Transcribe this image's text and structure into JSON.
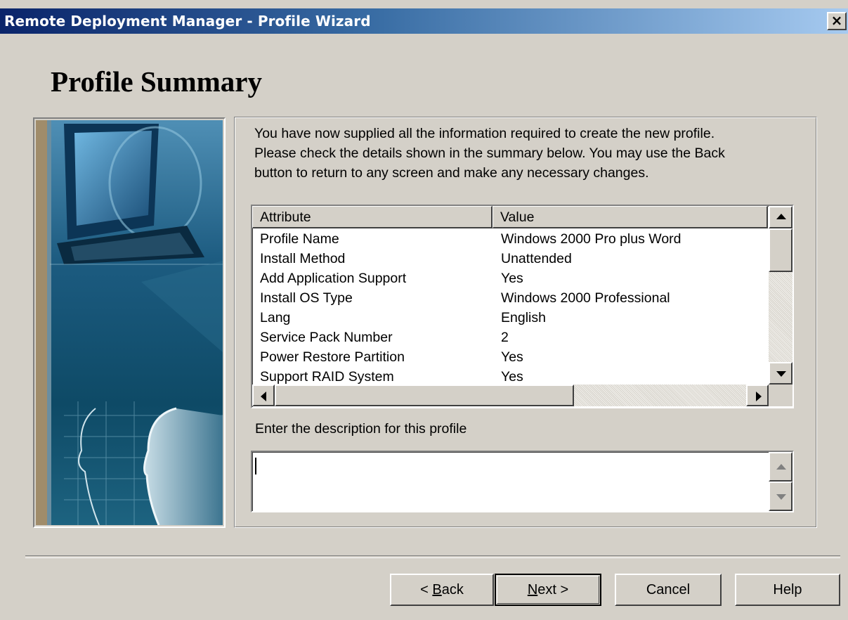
{
  "window": {
    "title": "Remote Deployment Manager - Profile Wizard",
    "close_label": "×"
  },
  "page": {
    "title": "Profile Summary"
  },
  "intro": {
    "lines": [
      "You have now supplied all the information required to create the new profile.",
      "Please check the details shown in the summary below.  You may use the Back",
      "button to return to any screen and make any necessary changes."
    ]
  },
  "summary_table": {
    "columns": [
      "Attribute",
      "Value"
    ],
    "rows": [
      {
        "attribute": "Profile Name",
        "value": "Windows 2000 Pro plus Word"
      },
      {
        "attribute": "Install Method",
        "value": "Unattended"
      },
      {
        "attribute": "Add Application Support",
        "value": "Yes"
      },
      {
        "attribute": "Install OS Type",
        "value": "Windows 2000 Professional"
      },
      {
        "attribute": "Lang",
        "value": "English"
      },
      {
        "attribute": "Service Pack Number",
        "value": "2"
      },
      {
        "attribute": "Power Restore Partition",
        "value": "Yes"
      },
      {
        "attribute": "Support RAID System",
        "value": "Yes"
      }
    ]
  },
  "description": {
    "label": "Enter the description for this profile",
    "value": ""
  },
  "buttons": {
    "back": {
      "pre": "< ",
      "mnemonic": "B",
      "post": "ack"
    },
    "next": {
      "mnemonic": "N",
      "post": "ext >"
    },
    "cancel": "Cancel",
    "help": "Help"
  },
  "colors": {
    "title_bar_start": "#0a246a",
    "title_bar_end": "#a6caf0",
    "dialog_face": "#d4d0c8"
  },
  "icons": {
    "side_banner": "monitor-and-profile-heads-illustration"
  }
}
